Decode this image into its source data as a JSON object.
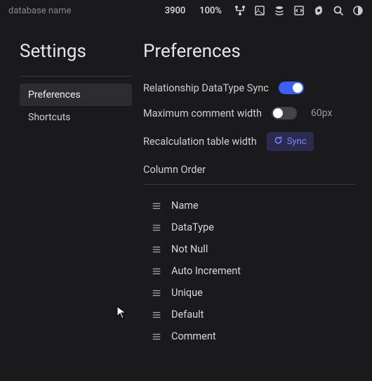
{
  "topbar": {
    "dbName": "database name",
    "number": "3900",
    "zoom": "100%"
  },
  "sidebar": {
    "title": "Settings",
    "items": [
      {
        "label": "Preferences",
        "active": true
      },
      {
        "label": "Shortcuts",
        "active": false
      }
    ]
  },
  "content": {
    "title": "Preferences",
    "relSync": {
      "label": "Relationship DataType Sync",
      "on": true
    },
    "maxWidth": {
      "label": "Maximum comment width",
      "on": false,
      "value": "60px"
    },
    "recalc": {
      "label": "Recalculation table width",
      "button": "Sync"
    },
    "columnOrder": {
      "label": "Column Order",
      "items": [
        "Name",
        "DataType",
        "Not Null",
        "Auto Increment",
        "Unique",
        "Default",
        "Comment"
      ]
    }
  }
}
